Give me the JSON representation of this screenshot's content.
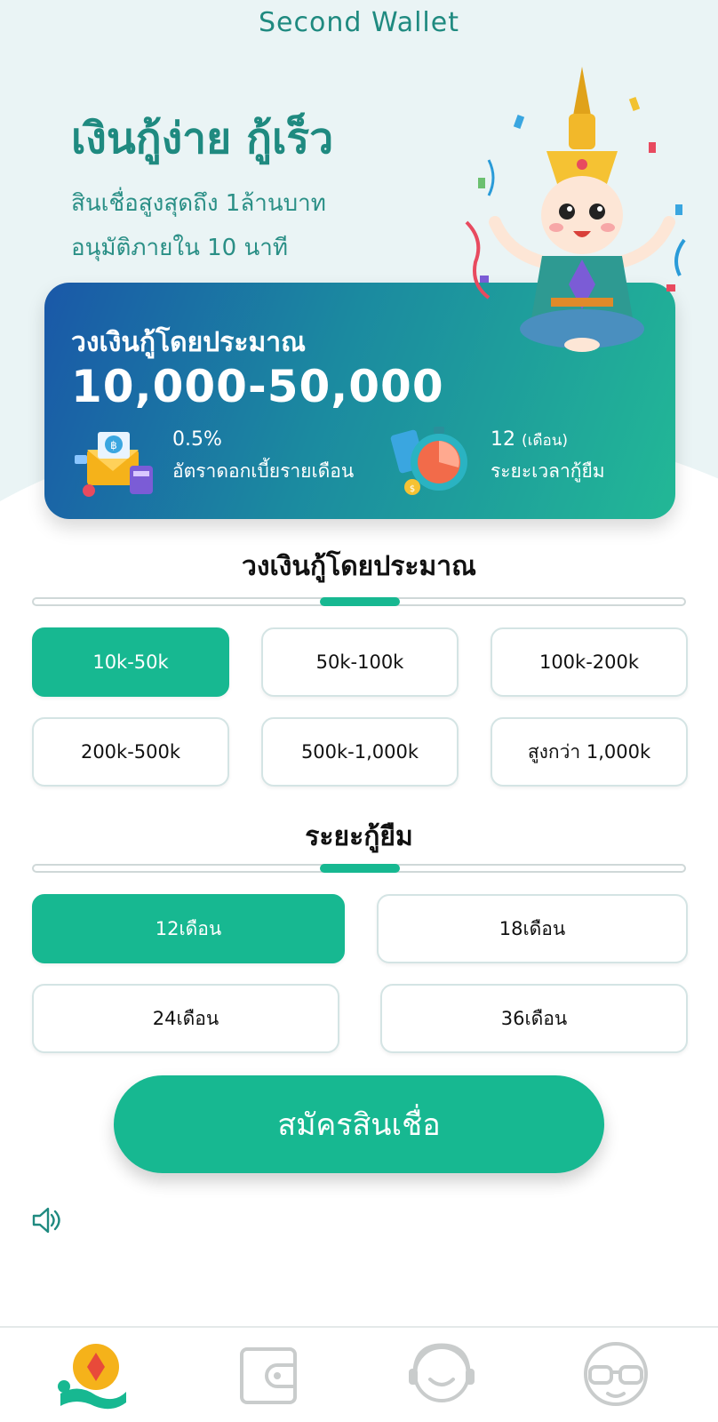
{
  "header": {
    "app_title": "Second Wallet"
  },
  "hero": {
    "headline": "เงินกู้ง่าย  กู้เร็ว",
    "subline_1": "สินเชื่อสูงสุดถึง 1ล้านบาท",
    "subline_2": "อนุมัติภายใน 10 นาที"
  },
  "card": {
    "label": "วงเงินกู้โดยประมาณ",
    "amount": "10,000-50,000",
    "rate_value": "0.5%",
    "rate_label": "อัตราดอกเบี้ยรายเดือน",
    "term_value": "12",
    "term_unit": "(เดือน)",
    "term_label": "ระยะเวลากู้ยืม"
  },
  "amount_section": {
    "title": "วงเงินกู้โดยประมาณ",
    "options": [
      "10k-50k",
      "50k-100k",
      "100k-200k",
      "200k-500k",
      "500k-1,000k",
      "สูงกว่า 1,000k"
    ],
    "selected": "10k-50k"
  },
  "term_section": {
    "title": "ระยะกู้ยืม",
    "options": [
      "12เดือน",
      "18เดือน",
      "24เดือน",
      "36เดือน"
    ],
    "selected": "12เดือน"
  },
  "apply_button": {
    "label": "สมัครสินเชื่อ"
  },
  "bottom_nav": {
    "items": [
      {
        "icon": "home-loan-icon",
        "active": true
      },
      {
        "icon": "wallet-icon",
        "active": false
      },
      {
        "icon": "customer-service-icon",
        "active": false
      },
      {
        "icon": "profile-glasses-icon",
        "active": false
      }
    ]
  },
  "colors": {
    "accent": "#17b891",
    "title_text": "#1f8a80",
    "hero_bg": "#eaf4f5",
    "card_gradient_start": "#1a58a8",
    "card_gradient_end": "#22b896"
  }
}
